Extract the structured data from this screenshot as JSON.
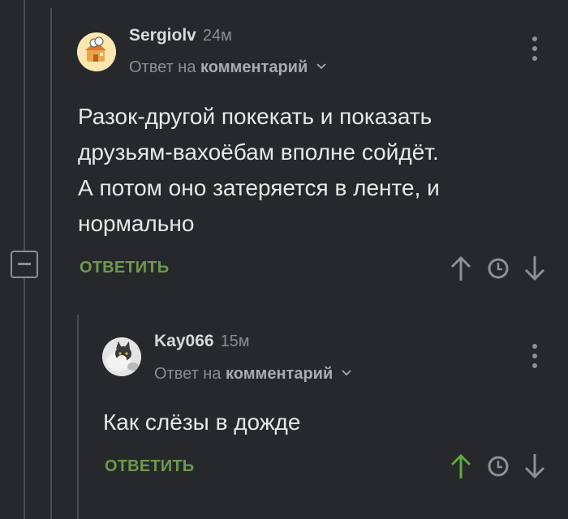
{
  "comments": [
    {
      "username": "Sergiolv",
      "time": "24м",
      "reply_prefix": "Ответ на",
      "reply_target": "комментарий",
      "text_lines": [
        "Разок-другой покекать и показать",
        "друзьям-вахоёбам вполне сойдёт.",
        "А потом оно затеряется в ленте, и",
        "нормально"
      ],
      "reply_label": "ОТВЕТИТЬ",
      "upvote_active": false
    },
    {
      "username": "Kay066",
      "time": "15м",
      "reply_prefix": "Ответ на",
      "reply_target": "комментарий",
      "text_lines": [
        "Как слёзы в дожде"
      ],
      "reply_label": "ОТВЕТИТЬ",
      "upvote_active": true
    }
  ],
  "colors": {
    "background": "#26282c",
    "reply_green": "#6d9a4d",
    "upvote_active": "#5fa83f",
    "icon_gray": "#8e9093"
  },
  "icons": [
    "kebab-menu-icon",
    "chevron-down-icon",
    "upvote-arrow-icon",
    "clock-icon",
    "downvote-arrow-icon",
    "collapse-minus-icon"
  ]
}
